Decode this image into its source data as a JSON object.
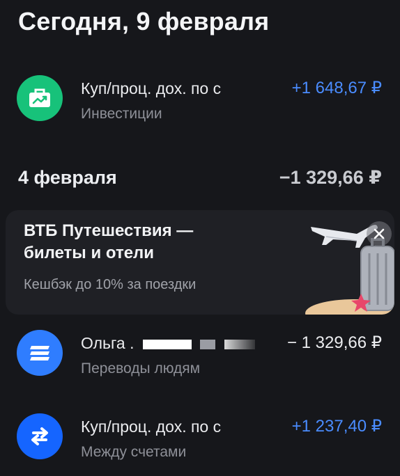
{
  "today_header": "Сегодня, 9 февраля",
  "transactions_today": [
    {
      "title": "Куп/проц. дох. по с",
      "category": "Инвестиции",
      "amount": "+1 648,67 ₽",
      "icon": "briefcase-chart-icon",
      "icon_color": "#17c27a"
    }
  ],
  "date_group": {
    "date": "4 февраля",
    "total": "−1 329,66 ₽"
  },
  "promo": {
    "title_line1": "ВТБ Путешествия —",
    "title_line2": "билеты и отели",
    "subtitle": "Кешбэк до 10% за поездки",
    "close_icon": "close-icon",
    "illustration": "airplane-suitcase-illustration"
  },
  "transactions_feb4": [
    {
      "title": "Ольга .",
      "category": "Переводы людям",
      "amount": "− 1 329,66 ₽",
      "icon": "transfer-lines-icon",
      "icon_color": "#2f7dff"
    },
    {
      "title": "Куп/проц. дох. по с",
      "category": "Между счетами",
      "amount": "+1 237,40 ₽",
      "icon": "swap-arrows-icon",
      "icon_color": "#1565ff"
    }
  ],
  "colors": {
    "background": "#16171b",
    "positive_amount": "#4a8cff",
    "promo_card": "#1f2025"
  }
}
